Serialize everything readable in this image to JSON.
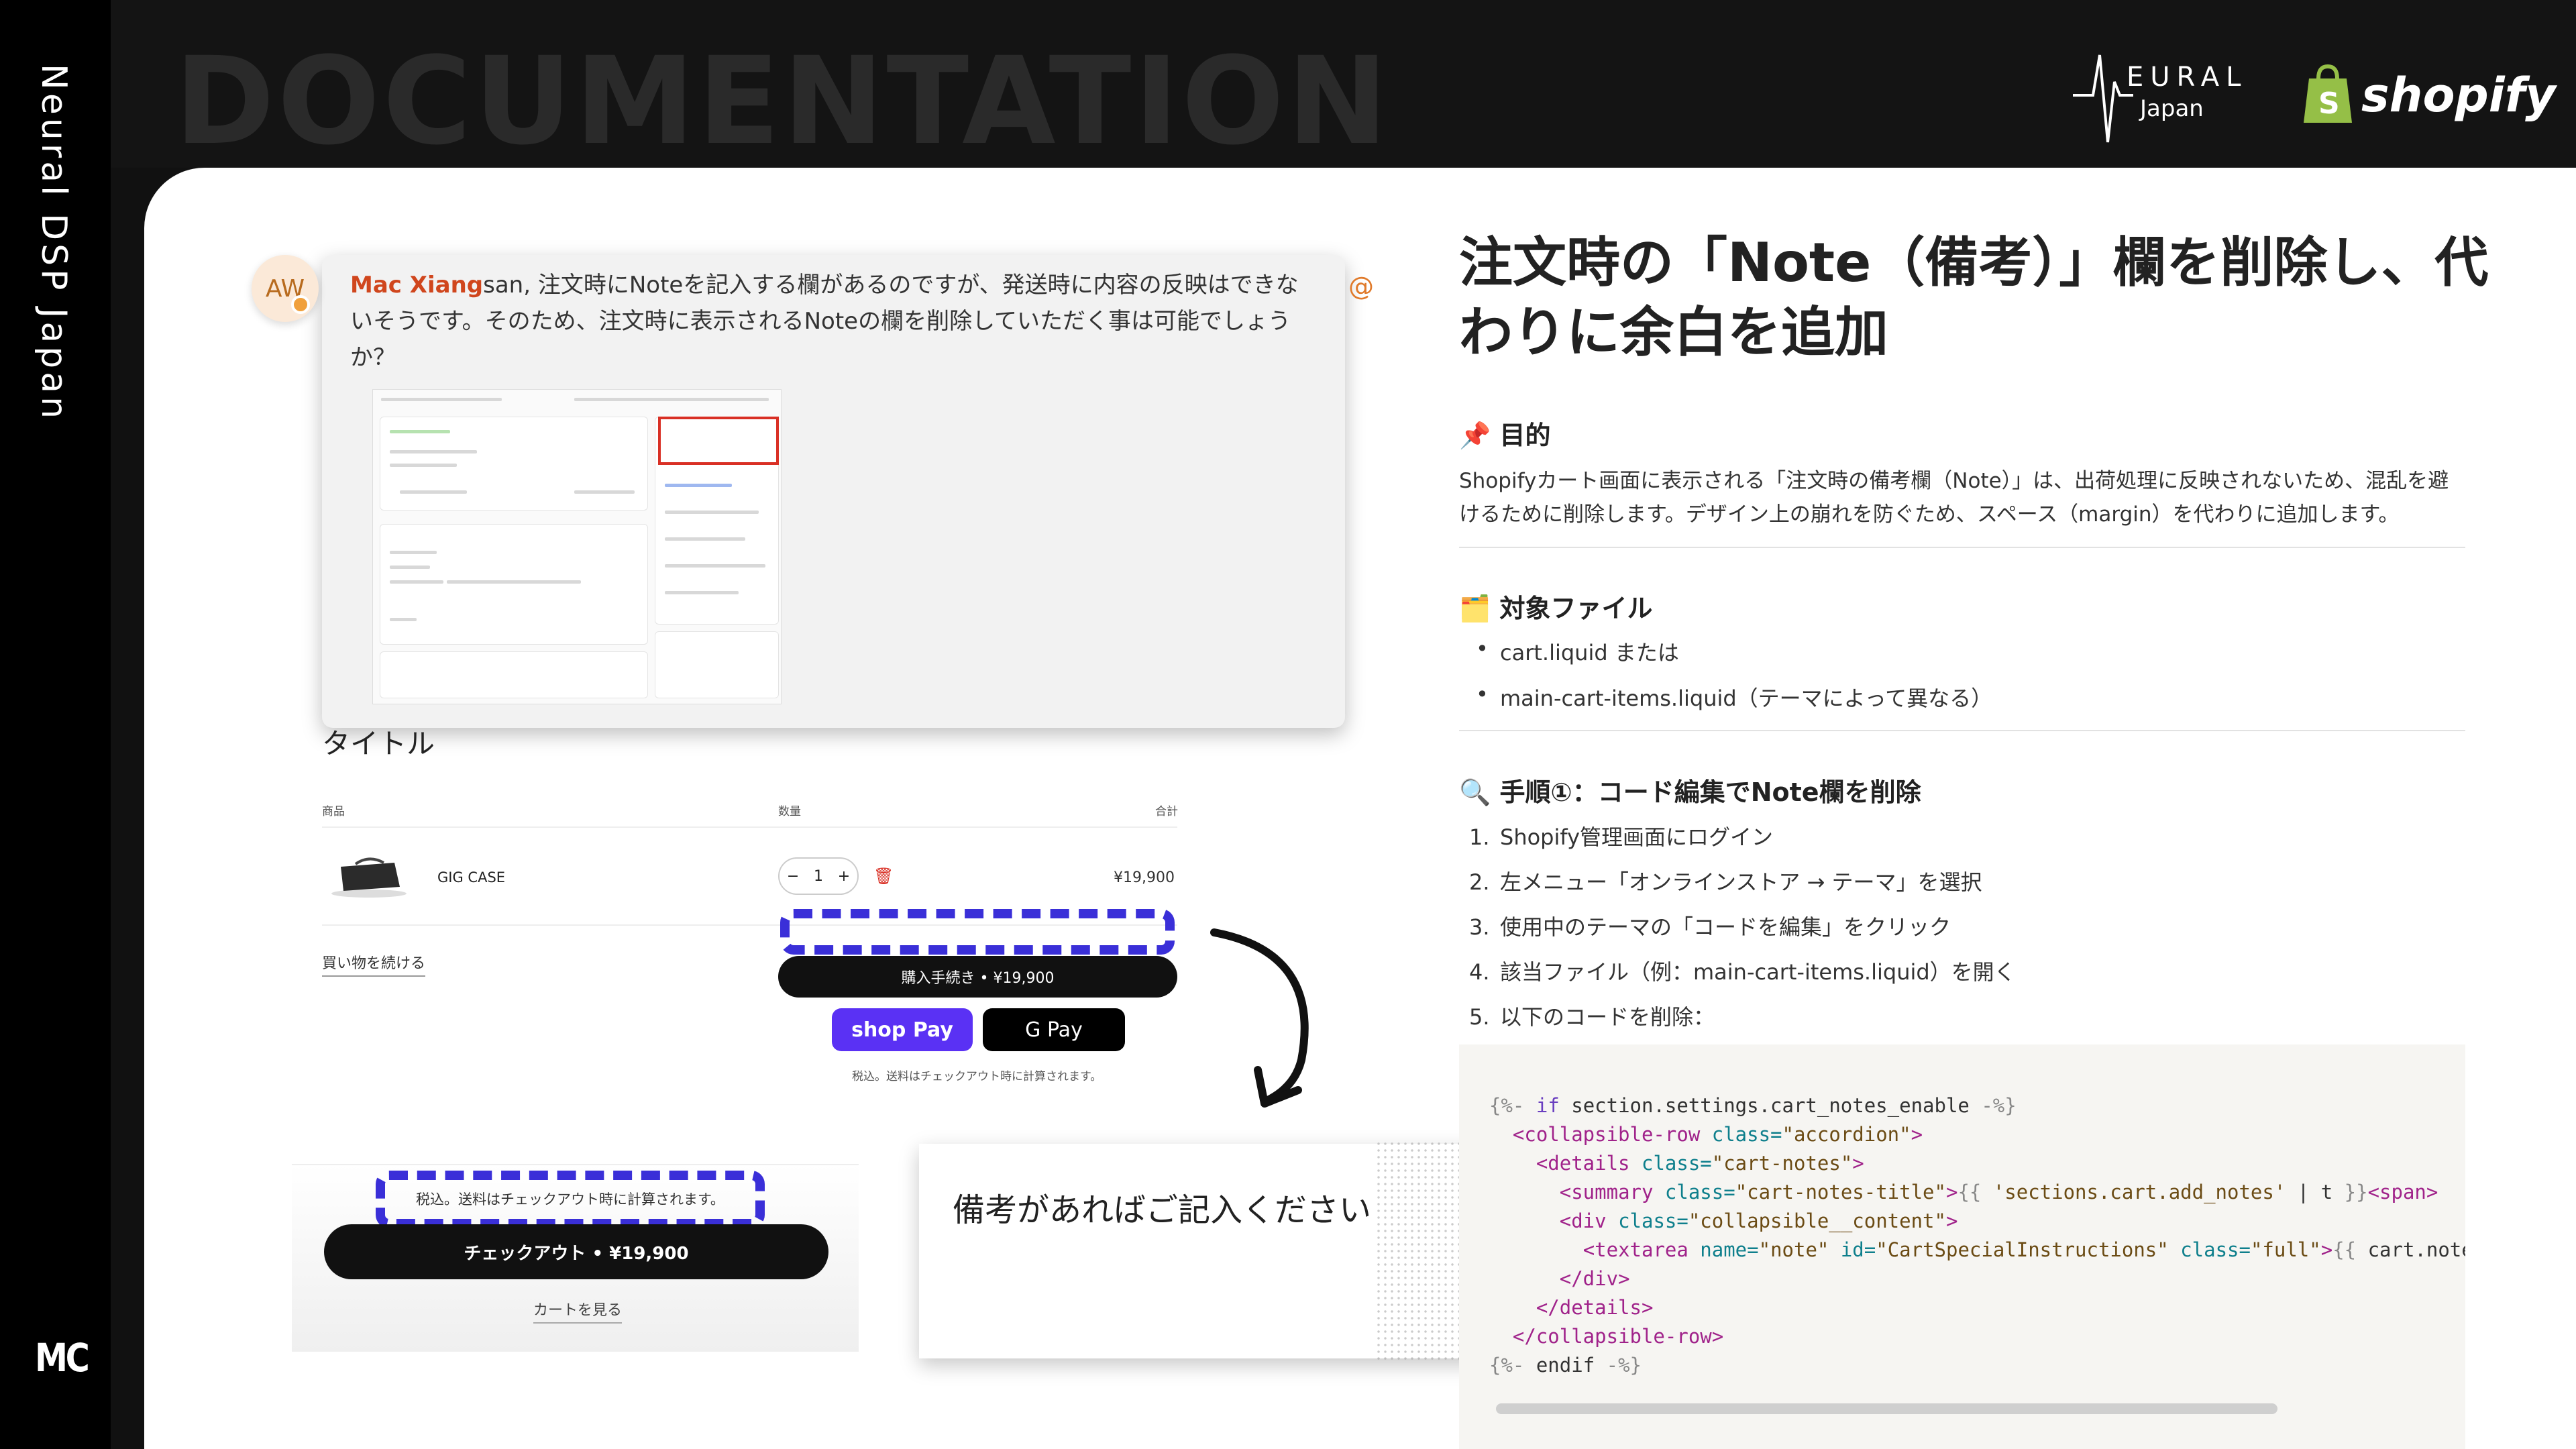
{
  "rail": {
    "title": "Neural DSP Japan",
    "mc": "MC"
  },
  "header": {
    "doc_title": "DOCUMENTATION",
    "neural_word": "EURAL",
    "neural_sub": "Japan",
    "shopify_word": "shopify"
  },
  "chat": {
    "avatar": "AW",
    "author": "Mac Xiang",
    "message": "san, 注文時にNoteを記入する欄があるのですが、発送時に内容の反映はできないそうです。そのため、注文時に表示されるNoteの欄を削除していただく事は可能でしょうか？",
    "at": "@"
  },
  "cart": {
    "title": "タイトル",
    "head_product": "商品",
    "head_qty": "数量",
    "head_total": "合計",
    "product_name": "GIG CASE",
    "qty_minus": "−",
    "qty_value": "1",
    "qty_plus": "+",
    "line_price": "¥19,900",
    "continue": "買い物を続ける",
    "checkout": "購入手続き • ¥19,900",
    "shoppay": "shop Pay",
    "gpay": "G Pay",
    "tax_note": "税込。送料はチェックアウト時に計算されます。"
  },
  "mobile": {
    "tax_note": "税込。送料はチェックアウト時に計算されます。",
    "checkout": "チェックアウト • ¥19,900",
    "view_cart": "カートを見る"
  },
  "note_card": {
    "placeholder": "備考があればご記入ください"
  },
  "right": {
    "title": "注文時の「Note（備考）」欄を削除し、代わりに余白を追加",
    "purpose_heading": "📌 目的",
    "purpose_body": "Shopifyカート画面に表示される「注文時の備考欄（Note）」は、出荷処理に反映されないため、混乱を避けるために削除します。デザイン上の崩れを防ぐため、スペース（margin）を代わりに追加します。",
    "files_heading": "🗂️ 対象ファイル",
    "files": [
      "cart.liquid または",
      "main-cart-items.liquid（テーマによって異なる）"
    ],
    "steps_heading": "🔍 手順①：コード編集でNote欄を削除",
    "steps": [
      "Shopify管理画面にログイン",
      "左メニュー「オンラインストア → テーマ」を選択",
      "使用中のテーマの「コードを編集」をクリック",
      "該当ファイル（例：main-cart-items.liquid）を開く",
      "以下のコードを削除："
    ]
  },
  "colors": {
    "accent_blue": "#3a2fd8",
    "author_orange": "#d0461d",
    "shoppay_purple": "#5a31f4"
  }
}
